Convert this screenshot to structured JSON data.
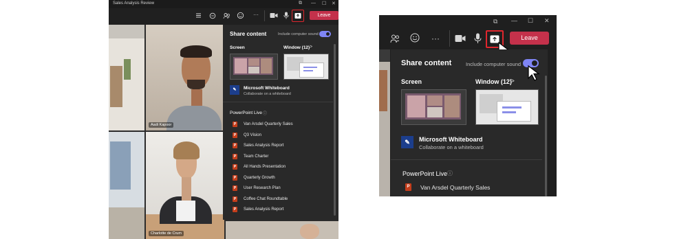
{
  "window": {
    "title": "Sales Analysis Review",
    "controls": [
      "⧉",
      "—",
      "☐",
      "✕"
    ]
  },
  "toolbar": {
    "icons": [
      "list-icon",
      "chat-icon",
      "people-icon",
      "reactions-icon",
      "more-icon",
      "camera-icon",
      "mic-icon",
      "share-icon"
    ],
    "more_label": "···",
    "leave_label": "Leave"
  },
  "participants": [
    {
      "name": "Aadi Kapoor"
    },
    {
      "name": "Charlotte de Crum"
    }
  ],
  "share_panel": {
    "title": "Share content",
    "sound_label": "Include computer sound",
    "sound_on": true,
    "screen_label": "Screen",
    "window_label": "Window (12)",
    "window_chevron": ">",
    "whiteboard_title": "Microsoft Whiteboard",
    "whiteboard_sub": "Collaborate on a whiteboard",
    "ppt_section": "PowerPoint Live",
    "ppt_items": [
      "Van Arsdel Quarterly Sales",
      "Q3 Vision",
      "Sales Analysis Report",
      "Team Charter",
      "All Hands Presentation",
      "Quarterly Growth",
      "User Research Plan",
      "Coffee Chat Roundtable",
      "Sales Analysis Report"
    ]
  },
  "colors": {
    "leave": "#c4314b",
    "accent_toggle": "#7f85f5",
    "highlight": "#e0262d",
    "panel_bg": "#292929"
  }
}
